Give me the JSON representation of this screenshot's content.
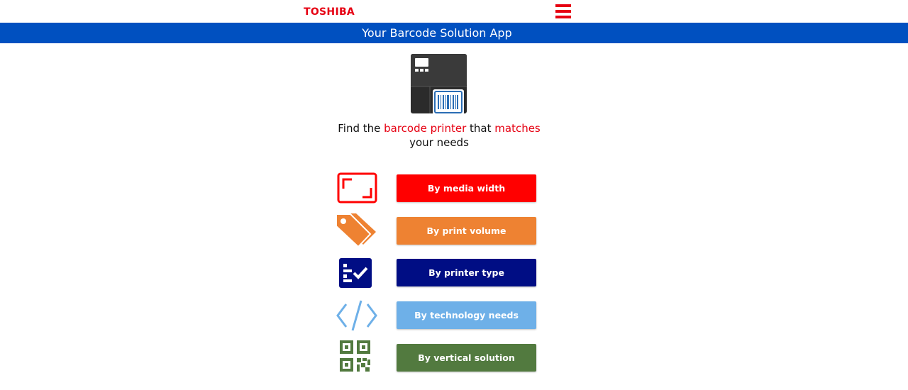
{
  "header": {
    "brand": "TOSHIBA",
    "menu_icon": "hamburger-menu-icon"
  },
  "appbar": {
    "title": "Your Barcode Solution App"
  },
  "hero": {
    "icon": "barcode-printer-icon",
    "headline_parts": [
      "Find the ",
      "barcode printer",
      " that ",
      "matches",
      " your needs"
    ]
  },
  "options": [
    {
      "label": "By media width",
      "icon": "frame-corners-icon",
      "color": "#ff0000"
    },
    {
      "label": "By print volume",
      "icon": "tags-icon",
      "color": "#ee8232"
    },
    {
      "label": "By printer type",
      "icon": "checklist-icon",
      "color": "#000d84"
    },
    {
      "label": "By technology needs",
      "icon": "code-icon",
      "color": "#6eb0e8"
    },
    {
      "label": "By vertical solution",
      "icon": "qr-code-icon",
      "color": "#527a3f"
    }
  ],
  "colors": {
    "brand_red": "#e60012",
    "appbar_blue": "#0050c0"
  }
}
